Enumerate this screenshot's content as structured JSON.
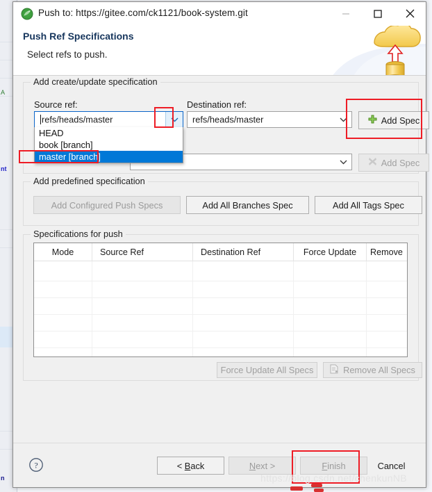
{
  "window": {
    "title": "Push to: https://gitee.com/ck1121/book-system.git",
    "icon": "git-push-icon",
    "controls": {
      "minimize": "minimize-icon",
      "maximize": "maximize-icon",
      "close": "close-icon"
    }
  },
  "header": {
    "title": "Push Ref Specifications",
    "subtitle": "Select refs to push.",
    "banner_icon": "cloud-upload-database-icon"
  },
  "create_update_group": {
    "legend": "Add create/update specification",
    "source_label": "Source ref:",
    "destination_label": "Destination ref:",
    "source_value": "refs/heads/master",
    "destination_value": "refs/heads/master",
    "add_spec_label": "Add Spec",
    "add_spec_icon": "green-plus-icon",
    "second_row": {
      "asterisk": "*",
      "value": "",
      "add_spec_label": "Add Spec",
      "add_spec_icon": "grey-x-icon",
      "disabled": true
    },
    "dropdown_items": [
      {
        "label": "HEAD",
        "selected": false
      },
      {
        "label": "book [branch]",
        "selected": false
      },
      {
        "label": "master [branch]",
        "selected": true
      }
    ]
  },
  "predefined_group": {
    "legend": "Add predefined specification",
    "buttons": [
      {
        "label": "Add Configured Push Specs",
        "disabled": true
      },
      {
        "label": "Add All Branches Spec",
        "disabled": false
      },
      {
        "label": "Add All Tags Spec",
        "disabled": false
      }
    ]
  },
  "specs_group": {
    "legend": "Specifications for push",
    "columns": [
      "Mode",
      "Source Ref",
      "Destination Ref",
      "Force Update",
      "Remove"
    ],
    "rows": [],
    "actions": [
      {
        "label": "Force Update All Specs",
        "disabled": true,
        "icon": ""
      },
      {
        "label": "Remove All Specs",
        "disabled": true,
        "icon": "remove-doc-icon"
      }
    ]
  },
  "footer": {
    "help_icon": "help-icon",
    "buttons": [
      {
        "label": "< Back",
        "mnemonic": "B",
        "disabled": false
      },
      {
        "label": "Next >",
        "mnemonic": "N",
        "disabled": true
      },
      {
        "label": "Finish",
        "mnemonic": "F",
        "disabled": true
      },
      {
        "label": "Cancel",
        "mnemonic": "",
        "disabled": false
      }
    ]
  },
  "watermark": {
    "text": "https://blog.csdn.net/chenkunNB"
  },
  "annotations": {
    "color": "#ee1c25",
    "boxes": [
      "source-ref-arrow",
      "master-branch-item",
      "add-spec-button",
      "finish-button"
    ]
  }
}
